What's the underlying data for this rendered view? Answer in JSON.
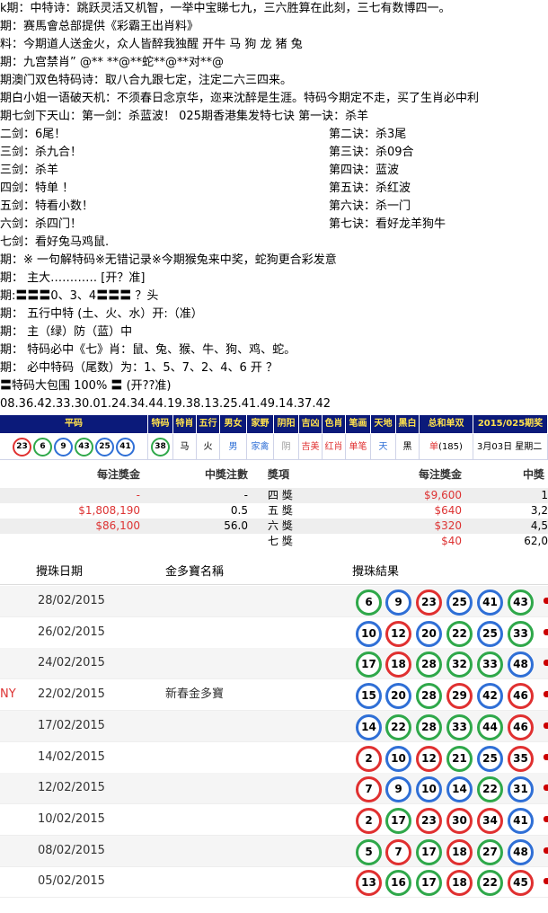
{
  "colors": {
    "red": "#e03030",
    "blue": "#2f6fd6",
    "green": "#2fa84a",
    "navy": "#0b1a7a",
    "gold": "#ffe14d"
  },
  "lines": [
    {
      "text": "k期：中特诗：跳跃灵活又机智，一举中宝睇七九，三六胜算在此刻，三七有数博四一。"
    },
    {
      "text": " 期：赛馬會总部提供《彩霸王出肖料》"
    },
    {
      "text": "料：今期道人送金火，众人皆醉我独醒    开牛 马 狗 龙 猪 兔"
    },
    {
      "text": "期：九宫禁肖”  @** **@**蛇**@**对**@"
    },
    {
      "text": "期澳门双色特码诗：取八合九跟七定，注定二六三四来。"
    },
    {
      "text": "期白小姐一语破天机：不须春日念京华，迩来沈醉是生涯。特码今期定不走，买了生肖必中利"
    },
    {
      "text": "期七剑下天山：第一剑：杀蓝波！        025期香港集发特七诀 第一诀：杀羊"
    },
    {
      "text": "二剑：6尾！",
      "right": "第二诀：杀3尾"
    },
    {
      "text": "三剑：杀九合！",
      "right": "第三诀：杀09合"
    },
    {
      "text": "三剑：杀羊",
      "right": "第四诀：蓝波"
    },
    {
      "text": "四剑：特单 ！",
      "right": "第五诀：杀红波"
    },
    {
      "text": "五剑：特看小数！",
      "right": "第六诀：杀一门"
    },
    {
      "text": "六剑：杀四门！",
      "right": "第七诀：看好龙羊狗牛"
    },
    {
      "text": "七剑：看好兔马鸡鼠."
    },
    {
      "text": "期：※ 一句解特码※无错记录※今期猴兔来中奖，蛇狗更合彩发意"
    },
    {
      "text": "期： 主大………… [开？准]"
    },
    {
      "text": "期:〓〓〓0、3、4〓〓〓 ？头"
    },
    {
      "text": "期： 五行中特   (土、火、水）开:（准）"
    },
    {
      "text": "期： 主（绿）防（蓝）中"
    },
    {
      "text": "期： 特码必中《七》肖：鼠、兔、猴、牛、狗、鸡、蛇。"
    },
    {
      "text": "期： 必中特码（尾数）为：1、5、7、2、4、6    开 ？"
    },
    {
      "text": "〓特码大包围 100% 〓  (开??准)"
    },
    {
      "text": "08.36.42.33.30.01.24.34.44.19.38.13.25.41.49.14.37.42"
    }
  ],
  "result_table": {
    "headers": [
      "平码",
      "特码",
      "特肖",
      "五行",
      "男女",
      "家野",
      "阴阳",
      "吉凶",
      "色肖",
      "笔画",
      "天地",
      "黑白",
      "总和单双",
      "2015/025期奖励"
    ],
    "balls": [
      {
        "n": "23",
        "c": "#e03030"
      },
      {
        "n": "6",
        "c": "#2fa84a"
      },
      {
        "n": "9",
        "c": "#2f6fd6"
      },
      {
        "n": "43",
        "c": "#2fa84a"
      },
      {
        "n": "25",
        "c": "#2f6fd6"
      },
      {
        "n": "41",
        "c": "#2f6fd6"
      }
    ],
    "special": {
      "n": "38",
      "c": "#2fa84a"
    },
    "cells": [
      {
        "v": "马",
        "c": "#000"
      },
      {
        "v": "火",
        "c": "#000"
      },
      {
        "v": "男",
        "c": "#2f6fd6"
      },
      {
        "v": "家禽",
        "c": "#2f6fd6"
      },
      {
        "v": "阴",
        "c": "#999"
      },
      {
        "v": "吉美",
        "c": "#e03030"
      },
      {
        "v": "红肖",
        "c": "#e03030"
      },
      {
        "v": "单笔",
        "c": "#e03030"
      },
      {
        "v": "天",
        "c": "#2f6fd6"
      },
      {
        "v": "黑",
        "c": "#000"
      }
    ],
    "sum_label": "单",
    "sum_value": "(185)",
    "date_text": "3月03日 星期二 21"
  },
  "prize": {
    "left_headers": [
      "每注獎金",
      "中獎注數"
    ],
    "right_headers": [
      "獎項",
      "每注獎金",
      "中獎"
    ],
    "left_rows": [
      {
        "amount": "-",
        "count": "-"
      },
      {
        "amount": "$1,808,190",
        "count": "0.5"
      },
      {
        "amount": "$86,100",
        "count": "56.0"
      }
    ],
    "right_rows": [
      {
        "name": "四 獎",
        "amount": "$9,600",
        "count": "1"
      },
      {
        "name": "五 獎",
        "amount": "$640",
        "count": "3,2"
      },
      {
        "name": "六 獎",
        "amount": "$320",
        "count": "4,5"
      },
      {
        "name": "七 獎",
        "amount": "$40",
        "count": "62,0"
      }
    ]
  },
  "draws": {
    "headers": [
      "攪珠日期",
      "金多寶名稱",
      "攪珠結果"
    ],
    "rows": [
      {
        "prefix": "",
        "date": "28/02/2015",
        "name": "",
        "balls": [
          [
            "6",
            "#2fa84a"
          ],
          [
            "9",
            "#2f6fd6"
          ],
          [
            "23",
            "#e03030"
          ],
          [
            "25",
            "#2f6fd6"
          ],
          [
            "41",
            "#2f6fd6"
          ],
          [
            "43",
            "#2fa84a"
          ]
        ]
      },
      {
        "prefix": "",
        "date": "26/02/2015",
        "name": "",
        "balls": [
          [
            "10",
            "#2f6fd6"
          ],
          [
            "12",
            "#e03030"
          ],
          [
            "20",
            "#2f6fd6"
          ],
          [
            "22",
            "#2fa84a"
          ],
          [
            "25",
            "#2f6fd6"
          ],
          [
            "33",
            "#2fa84a"
          ]
        ]
      },
      {
        "prefix": "",
        "date": "24/02/2015",
        "name": "",
        "balls": [
          [
            "17",
            "#2fa84a"
          ],
          [
            "18",
            "#e03030"
          ],
          [
            "28",
            "#2fa84a"
          ],
          [
            "32",
            "#2fa84a"
          ],
          [
            "33",
            "#2fa84a"
          ],
          [
            "48",
            "#2f6fd6"
          ]
        ]
      },
      {
        "prefix": "NY",
        "date": "22/02/2015",
        "name": "新春金多寶",
        "balls": [
          [
            "15",
            "#2f6fd6"
          ],
          [
            "20",
            "#2f6fd6"
          ],
          [
            "28",
            "#2fa84a"
          ],
          [
            "29",
            "#e03030"
          ],
          [
            "42",
            "#2f6fd6"
          ],
          [
            "46",
            "#e03030"
          ]
        ]
      },
      {
        "prefix": "",
        "date": "17/02/2015",
        "name": "",
        "balls": [
          [
            "14",
            "#2f6fd6"
          ],
          [
            "22",
            "#2fa84a"
          ],
          [
            "28",
            "#2fa84a"
          ],
          [
            "33",
            "#2fa84a"
          ],
          [
            "44",
            "#2fa84a"
          ],
          [
            "46",
            "#e03030"
          ]
        ]
      },
      {
        "prefix": "",
        "date": "14/02/2015",
        "name": "",
        "balls": [
          [
            "2",
            "#e03030"
          ],
          [
            "10",
            "#2f6fd6"
          ],
          [
            "12",
            "#e03030"
          ],
          [
            "21",
            "#2fa84a"
          ],
          [
            "25",
            "#2f6fd6"
          ],
          [
            "35",
            "#e03030"
          ]
        ]
      },
      {
        "prefix": "",
        "date": "12/02/2015",
        "name": "",
        "balls": [
          [
            "7",
            "#e03030"
          ],
          [
            "9",
            "#2f6fd6"
          ],
          [
            "10",
            "#2f6fd6"
          ],
          [
            "14",
            "#2f6fd6"
          ],
          [
            "22",
            "#2fa84a"
          ],
          [
            "31",
            "#2f6fd6"
          ]
        ]
      },
      {
        "prefix": "",
        "date": "10/02/2015",
        "name": "",
        "balls": [
          [
            "2",
            "#e03030"
          ],
          [
            "17",
            "#2fa84a"
          ],
          [
            "23",
            "#e03030"
          ],
          [
            "30",
            "#e03030"
          ],
          [
            "34",
            "#e03030"
          ],
          [
            "41",
            "#2f6fd6"
          ]
        ]
      },
      {
        "prefix": "",
        "date": "08/02/2015",
        "name": "",
        "balls": [
          [
            "5",
            "#2fa84a"
          ],
          [
            "7",
            "#e03030"
          ],
          [
            "17",
            "#2fa84a"
          ],
          [
            "18",
            "#e03030"
          ],
          [
            "27",
            "#2fa84a"
          ],
          [
            "48",
            "#2f6fd6"
          ]
        ]
      },
      {
        "prefix": "",
        "date": "05/02/2015",
        "name": "",
        "balls": [
          [
            "13",
            "#e03030"
          ],
          [
            "16",
            "#2fa84a"
          ],
          [
            "17",
            "#2fa84a"
          ],
          [
            "18",
            "#e03030"
          ],
          [
            "22",
            "#2fa84a"
          ],
          [
            "45",
            "#e03030"
          ]
        ]
      }
    ]
  }
}
